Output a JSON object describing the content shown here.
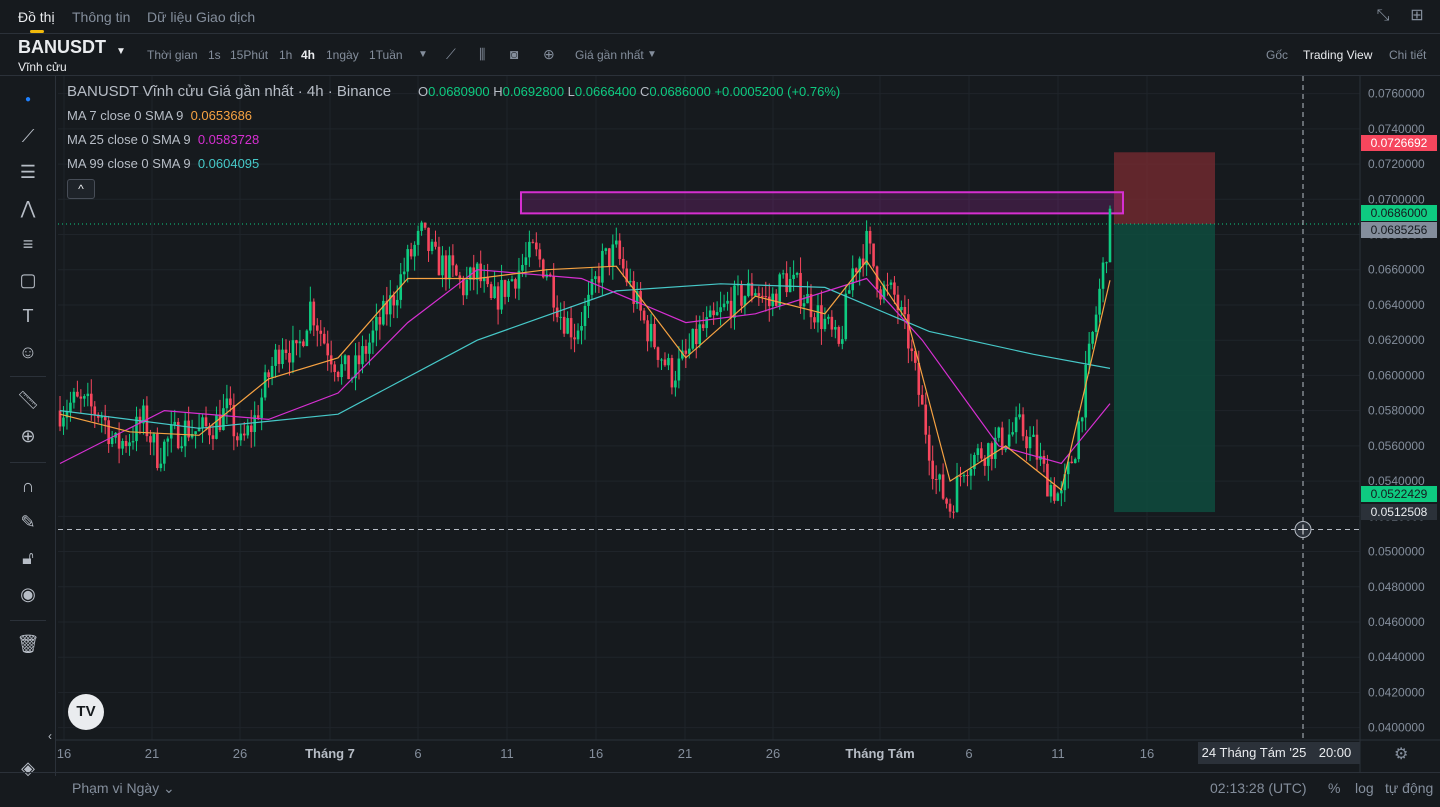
{
  "topbar": {
    "tabs": [
      "Đồ thị",
      "Thông tin",
      "Dữ liệu Giao dịch"
    ],
    "icons": [
      "collapse-icon",
      "grid-layout-icon"
    ]
  },
  "header": {
    "symbol": "BANUSDT",
    "subtitle": "Vĩnh cửu",
    "time_label": "Thời gian",
    "intervals": [
      "1s",
      "15Phút",
      "1h",
      "4h",
      "1ngày",
      "1Tuần"
    ],
    "active_interval": "4h",
    "price_type": "Giá gần nhất",
    "views": [
      "Gốc",
      "Trading View",
      "Chi tiết"
    ],
    "active_view": "Trading View"
  },
  "legend": {
    "title": "BANUSDT Vĩnh cửu Giá gần nhất · 4h · Binance",
    "o_label": "O",
    "o": "0.0680900",
    "h_label": "H",
    "h": "0.0692800",
    "l_label": "L",
    "l": "0.0666400",
    "c_label": "C",
    "c": "0.0686000",
    "change": "+0.0005200 (+0.76%)",
    "ma7_label": "MA 7 close 0 SMA 9",
    "ma7_value": "0.0653686",
    "ma25_label": "MA 25 close 0 SMA 9",
    "ma25_value": "0.0583728",
    "ma99_label": "MA 99 close 0 SMA 9",
    "ma99_value": "0.0604095",
    "collapse": "^"
  },
  "colors": {
    "up": "#0ecb81",
    "down": "#f6465d",
    "ma7": "#f6a242",
    "ma25": "#d62fd1",
    "ma99": "#46c8c8",
    "zone": "#d62fd1",
    "stop": "#7b2b32",
    "target": "#0e4f40"
  },
  "price_tags": {
    "stop": "0.0726692",
    "current": "0.0686000",
    "ma": "0.0685256",
    "target": "0.0522429",
    "crosshair": "0.0512508"
  },
  "crosshair_time": "24 Tháng Tám '25",
  "crosshair_hour": "20:00",
  "bottom": {
    "range": "Phạm vi Ngày",
    "clock": "02:13:28 (UTC)",
    "percent": "%",
    "log": "log",
    "auto": "tự động"
  },
  "tv_logo": "TV",
  "chart_data": {
    "type": "candlestick",
    "title": "BANUSDT Vĩnh cửu Giá gần nhất · 4h · Binance",
    "y_ticks": [
      "0.0760000",
      "0.0740000",
      "0.0720000",
      "0.0700000",
      "0.0680000",
      "0.0660000",
      "0.0640000",
      "0.0620000",
      "0.0600000",
      "0.0580000",
      "0.0560000",
      "0.0540000",
      "0.0520000",
      "0.0500000",
      "0.0480000",
      "0.0460000",
      "0.0440000",
      "0.0420000",
      "0.0400000"
    ],
    "ylim": [
      0.0393,
      0.077
    ],
    "x_ticks": [
      "16",
      "21",
      "26",
      "Tháng 7",
      "6",
      "11",
      "16",
      "21",
      "26",
      "Tháng Tám",
      "6",
      "11",
      "16"
    ],
    "close_path": [
      [
        0,
        0.058
      ],
      [
        4,
        0.0585
      ],
      [
        8,
        0.0582
      ],
      [
        12,
        0.0578
      ],
      [
        16,
        0.056
      ],
      [
        20,
        0.0565
      ],
      [
        24,
        0.0575
      ],
      [
        28,
        0.0555
      ],
      [
        32,
        0.0565
      ],
      [
        36,
        0.057
      ],
      [
        40,
        0.0568
      ],
      [
        44,
        0.0572
      ],
      [
        48,
        0.058
      ],
      [
        52,
        0.056
      ],
      [
        56,
        0.0575
      ],
      [
        60,
        0.06
      ],
      [
        64,
        0.062
      ],
      [
        68,
        0.061
      ],
      [
        72,
        0.064
      ],
      [
        76,
        0.062
      ],
      [
        80,
        0.0605
      ],
      [
        84,
        0.06
      ],
      [
        88,
        0.0615
      ],
      [
        92,
        0.063
      ],
      [
        96,
        0.0645
      ],
      [
        100,
        0.0665
      ],
      [
        104,
        0.068
      ],
      [
        108,
        0.0665
      ],
      [
        112,
        0.066
      ],
      [
        116,
        0.065
      ],
      [
        120,
        0.0658
      ],
      [
        124,
        0.064
      ],
      [
        128,
        0.065
      ],
      [
        132,
        0.066
      ],
      [
        136,
        0.067
      ],
      [
        140,
        0.066
      ],
      [
        144,
        0.0635
      ],
      [
        148,
        0.0625
      ],
      [
        152,
        0.064
      ],
      [
        156,
        0.0665
      ],
      [
        160,
        0.067
      ],
      [
        164,
        0.065
      ],
      [
        168,
        0.063
      ],
      [
        172,
        0.0615
      ],
      [
        176,
        0.06
      ],
      [
        180,
        0.061
      ],
      [
        184,
        0.0625
      ],
      [
        188,
        0.063
      ],
      [
        192,
        0.064
      ],
      [
        196,
        0.0645
      ],
      [
        200,
        0.065
      ],
      [
        204,
        0.064
      ],
      [
        208,
        0.0655
      ],
      [
        212,
        0.065
      ],
      [
        216,
        0.064
      ],
      [
        220,
        0.063
      ],
      [
        224,
        0.0615
      ],
      [
        228,
        0.066
      ],
      [
        232,
        0.0675
      ],
      [
        236,
        0.065
      ],
      [
        240,
        0.0645
      ],
      [
        244,
        0.062
      ],
      [
        248,
        0.058
      ],
      [
        252,
        0.054
      ],
      [
        256,
        0.0525
      ],
      [
        260,
        0.055
      ],
      [
        264,
        0.0555
      ],
      [
        268,
        0.056
      ],
      [
        272,
        0.0565
      ],
      [
        276,
        0.057
      ],
      [
        280,
        0.056
      ],
      [
        284,
        0.054
      ],
      [
        288,
        0.053
      ],
      [
        292,
        0.056
      ],
      [
        296,
        0.061
      ],
      [
        300,
        0.066
      ],
      [
        302,
        0.0686
      ]
    ],
    "ma7": [
      [
        0,
        0.0578
      ],
      [
        20,
        0.0568
      ],
      [
        40,
        0.0566
      ],
      [
        60,
        0.0598
      ],
      [
        80,
        0.061
      ],
      [
        100,
        0.0655
      ],
      [
        120,
        0.0655
      ],
      [
        140,
        0.066
      ],
      [
        160,
        0.0662
      ],
      [
        180,
        0.061
      ],
      [
        200,
        0.0645
      ],
      [
        220,
        0.0635
      ],
      [
        232,
        0.0665
      ],
      [
        244,
        0.063
      ],
      [
        256,
        0.054
      ],
      [
        272,
        0.056
      ],
      [
        288,
        0.0535
      ],
      [
        302,
        0.0654
      ]
    ],
    "ma25": [
      [
        0,
        0.055
      ],
      [
        30,
        0.058
      ],
      [
        60,
        0.0575
      ],
      [
        80,
        0.059
      ],
      [
        100,
        0.063
      ],
      [
        120,
        0.066
      ],
      [
        150,
        0.0655
      ],
      [
        180,
        0.063
      ],
      [
        200,
        0.0635
      ],
      [
        232,
        0.0655
      ],
      [
        248,
        0.062
      ],
      [
        270,
        0.056
      ],
      [
        288,
        0.055
      ],
      [
        302,
        0.0584
      ]
    ],
    "ma99": [
      [
        0,
        0.058
      ],
      [
        40,
        0.057
      ],
      [
        80,
        0.0578
      ],
      [
        120,
        0.062
      ],
      [
        160,
        0.0648
      ],
      [
        190,
        0.0652
      ],
      [
        220,
        0.065
      ],
      [
        250,
        0.0625
      ],
      [
        280,
        0.0612
      ],
      [
        302,
        0.0604
      ]
    ],
    "resistance_zone": [
      0.0692,
      0.0704
    ],
    "position": {
      "entry": 0.0686,
      "stop": 0.0726692,
      "target": 0.0522429
    },
    "crosshair_price": 0.0512508
  }
}
